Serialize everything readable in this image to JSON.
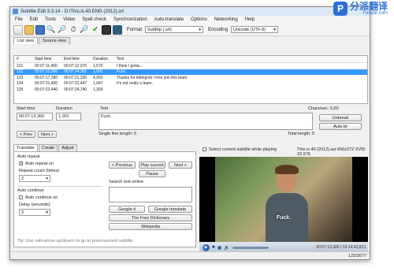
{
  "window": {
    "title": "Subtitle Edit 3.3.14 - D:\\This.is.40.ENG (2012).srt"
  },
  "watermark": {
    "logo_letter": "P",
    "cn_text": "分派翻译",
    "en_text": "Fenpie.com"
  },
  "menu": [
    "File",
    "Edit",
    "Tools",
    "Video",
    "Spell check",
    "Synchronization",
    "Auto-translate",
    "Options",
    "Networking",
    "Help"
  ],
  "toolbar": {
    "format_label": "Format",
    "format_value": "SubRip (.srt)",
    "encoding_label": "Encoding",
    "encoding_value": "Unicode (UTF-8)"
  },
  "view_tabs": [
    "List view",
    "Source view"
  ],
  "grid": {
    "headers": [
      "#",
      "Start time",
      "End time",
      "Duration",
      "Text"
    ],
    "rows": [
      {
        "num": "121",
        "start": "00:07:11,400",
        "end": "00:07:12,970",
        "dur": "1,570",
        "text": "I think I gotta...",
        "selected": false
      },
      {
        "num": "122",
        "start": "00:07:13,360",
        "end": "00:07:14,361",
        "dur": "1,001",
        "text": "Fuck.",
        "selected": true
      },
      {
        "num": "123",
        "start": "00:07:17,280",
        "end": "00:07:21,330",
        "dur": "4,050",
        "text": "Thanks for letting<br />me join this team.",
        "selected": false
      },
      {
        "num": "124",
        "start": "00:07:21,400",
        "end": "00:07:22,447",
        "dur": "1,047",
        "text": "It's not really a team.",
        "selected": false
      },
      {
        "num": "125",
        "start": "00:07:23,440",
        "end": "00:07:24,740",
        "dur": "1,300",
        "text": "",
        "selected": false
      }
    ]
  },
  "editor": {
    "start_time_label": "Start time",
    "duration_label": "Duration",
    "text_label": "Text",
    "start_time_value": "00:07:13,360",
    "duration_value": "1,001",
    "text_value": "Fuck.",
    "chars_sec": "Chars/sec: 5,00",
    "single_line_length": "Single line length: 5",
    "total_length": "Total length: 5",
    "prev_button": "< Prev",
    "next_button": "Next >",
    "unbreak_button": "Unbreak",
    "auto_br_button": "Auto br"
  },
  "lower_tabs": [
    "Translate",
    "Create",
    "Adjust"
  ],
  "translate": {
    "auto_repeat_label": "Auto repeat",
    "auto_repeat_on": "Auto repeat on",
    "repeat_count_label": "Repeat count (times)",
    "repeat_count_value": "2",
    "auto_continue_label": "Auto continue",
    "auto_continue_on": "Auto continue on",
    "delay_label": "Delay (seconds)",
    "delay_value": "3",
    "previous_button": "< Previous",
    "play_current_button": "Play current",
    "next_button": "Next >",
    "pause_button": "Pause",
    "search_online_label": "Search text online",
    "google_it_button": "Google it",
    "google_translate_button": "Google translate",
    "free_dictionary_button": "The Free Dictionary",
    "wikipedia_button": "Wikipedia",
    "tip": "Tip: Use <alt+arrow up/down> to go to previous/next subtitle"
  },
  "video": {
    "select_current_label": "Select current subtitle while playing",
    "file_info": "This is 40 (2012).avi 656x272 XVID 23.976",
    "subtitle_text": "Fuck.",
    "timecode": "00:07:13,380 / 02:14:43,823"
  },
  "status": {
    "position": "122/2677"
  }
}
